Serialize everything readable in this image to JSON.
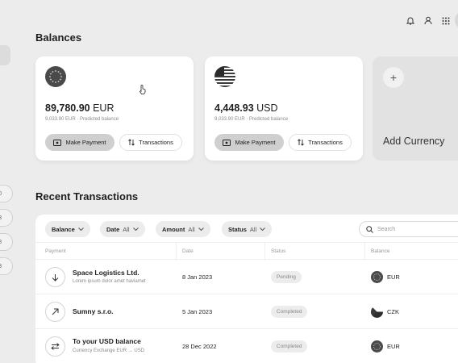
{
  "topbar": {
    "icons": [
      "bell-icon",
      "user-icon",
      "grid-icon"
    ]
  },
  "side_values": [
    "0",
    "3",
    "8",
    "3"
  ],
  "balances_heading": "Balances",
  "cards": [
    {
      "currency_icon": "eu-flag",
      "amount": "89,780.90",
      "currency": "EUR",
      "sub": "9,033.90 EUR · Predicted balance",
      "make_payment": "Make Payment",
      "transactions": "Transactions"
    },
    {
      "currency_icon": "us-flag",
      "amount": "4,448.93",
      "currency": "USD",
      "sub": "9,033.90 EUR · Predicted balance",
      "make_payment": "Make Payment",
      "transactions": "Transactions"
    }
  ],
  "add_currency": {
    "plus": "+",
    "label": "Add Currency"
  },
  "recent_heading": "Recent Transactions",
  "filters": [
    {
      "label": "Balance",
      "value": ""
    },
    {
      "label": "Date",
      "value": "All"
    },
    {
      "label": "Amount",
      "value": "All"
    },
    {
      "label": "Status",
      "value": "All"
    }
  ],
  "search": {
    "placeholder": "Search"
  },
  "columns": {
    "payment": "Payment",
    "date": "Date",
    "status": "Status",
    "balance": "Balance"
  },
  "transactions": [
    {
      "icon": "arrow-down-icon",
      "title": "Space Logistics Ltd.",
      "desc": "Lorem ipsum dolor amet haviamet",
      "date": "8 Jan 2023",
      "status": "Pending",
      "balance_currency": "EUR",
      "balance_icon": "eu-flag"
    },
    {
      "icon": "arrow-up-right-icon",
      "title": "Sumny s.r.o.",
      "desc": "",
      "date": "5 Jan 2023",
      "status": "Completed",
      "balance_currency": "CZK",
      "balance_icon": "cz-flag"
    },
    {
      "icon": "exchange-icon",
      "title": "To your USD balance",
      "desc": "Currency Exchange EUR → USD",
      "date": "28 Dec 2022",
      "status": "Completed",
      "balance_currency": "EUR",
      "balance_icon": "eu-flag"
    }
  ]
}
